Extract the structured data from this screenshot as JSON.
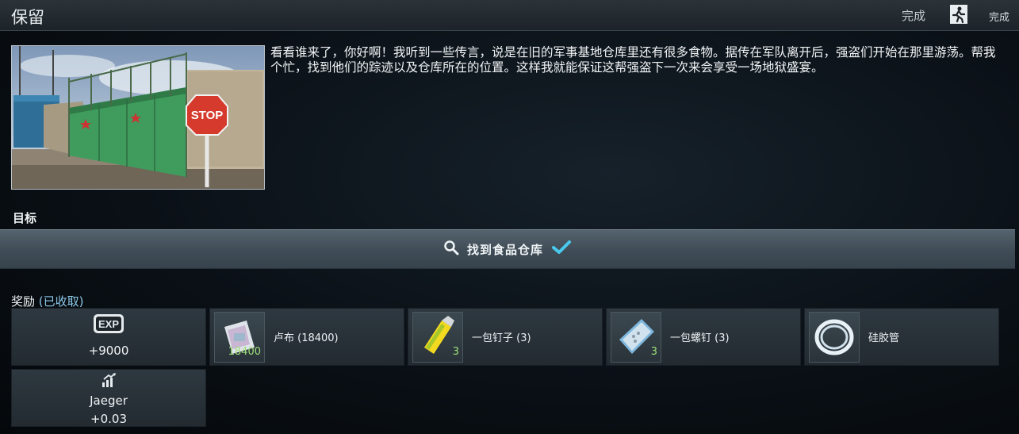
{
  "header": {
    "title": "保留",
    "status": "完成",
    "status_button": "完成",
    "exit_icon": "running-exit-icon"
  },
  "quest": {
    "image_sign": "STOP",
    "description": "看看谁来了，你好啊！我听到一些传言，说是在旧的军事基地仓库里还有很多食物。据传在军队离开后，强盗们开始在那里游荡。帮我个忙，找到他们的踪迹以及仓库所在的位置。这样我就能保证这帮强盗下一次来会享受一场地狱盛宴。"
  },
  "objectives": {
    "label": "目标",
    "items": [
      {
        "text": "找到食品仓库",
        "icon": "search-icon",
        "status_icon": "checkmark-icon",
        "completed": true
      }
    ]
  },
  "rewards": {
    "label": "奖励",
    "note": "(已收取)",
    "exp": {
      "badge": "EXP",
      "value": "+9000"
    },
    "standing": {
      "trader": "Jaeger",
      "value": "+0.03",
      "icon": "standing-up-icon"
    },
    "items": [
      {
        "label": "卢布 (18400)",
        "count": "18400",
        "icon": "roubles-icon"
      },
      {
        "label": "一包钉子 (3)",
        "count": "3",
        "icon": "nails-pack-icon"
      },
      {
        "label": "一包螺钉 (3)",
        "count": "3",
        "icon": "screws-pack-icon"
      },
      {
        "label": "硅胶管",
        "count": "",
        "icon": "silicone-tube-icon"
      }
    ]
  },
  "colors": {
    "accent": "#8cc8e8",
    "check": "#49c9ee",
    "count": "#9fe07a",
    "objective_bar": "#4a5863"
  }
}
